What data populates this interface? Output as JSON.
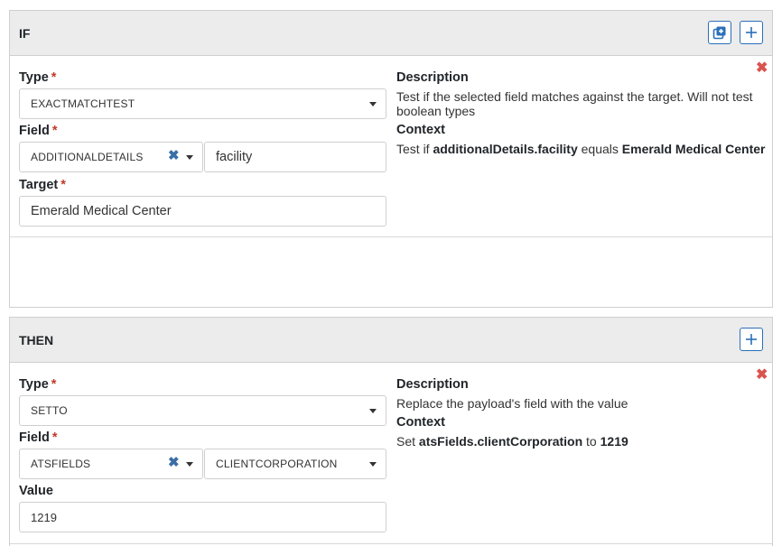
{
  "if_block": {
    "title": "IF",
    "condition": {
      "type_label": "Type",
      "type_value": "EXACTMATCHTEST",
      "field_label": "Field",
      "field_value": "ADDITIONALDETAILS",
      "subfield_value": "facility",
      "target_label": "Target",
      "target_value": "Emerald Medical Center",
      "description_heading": "Description",
      "description_text": "Test if the selected field matches against the target. Will not test boolean types",
      "context_heading": "Context",
      "context_prefix": "Test if",
      "context_field": "additionalDetails.facility",
      "context_mid": "equals",
      "context_value": "Emerald Medical Center"
    }
  },
  "then_block": {
    "title": "THEN",
    "action": {
      "type_label": "Type",
      "type_value": "SETTO",
      "field_label": "Field",
      "field_value": "ATSFIELDS",
      "subfield_value": "CLIENTCORPORATION",
      "value_label": "Value",
      "value_value": "1219",
      "description_heading": "Description",
      "description_text": "Replace the payload's field with the value",
      "context_heading": "Context",
      "context_prefix": "Set",
      "context_field": "atsFields.clientCorporation",
      "context_mid": "to",
      "context_value": "1219"
    }
  },
  "symbols": {
    "required": "*",
    "clear": "✖",
    "delete": "✖"
  },
  "icons": {
    "copy": "copy-icon",
    "add": "plus-icon",
    "clear": "clear-x-icon",
    "delete": "delete-x-icon",
    "caret": "caret-down-icon"
  },
  "colors": {
    "accent": "#2a6fb8",
    "danger": "#d9534f",
    "required": "#c0392b",
    "header_bg": "#ececec"
  }
}
